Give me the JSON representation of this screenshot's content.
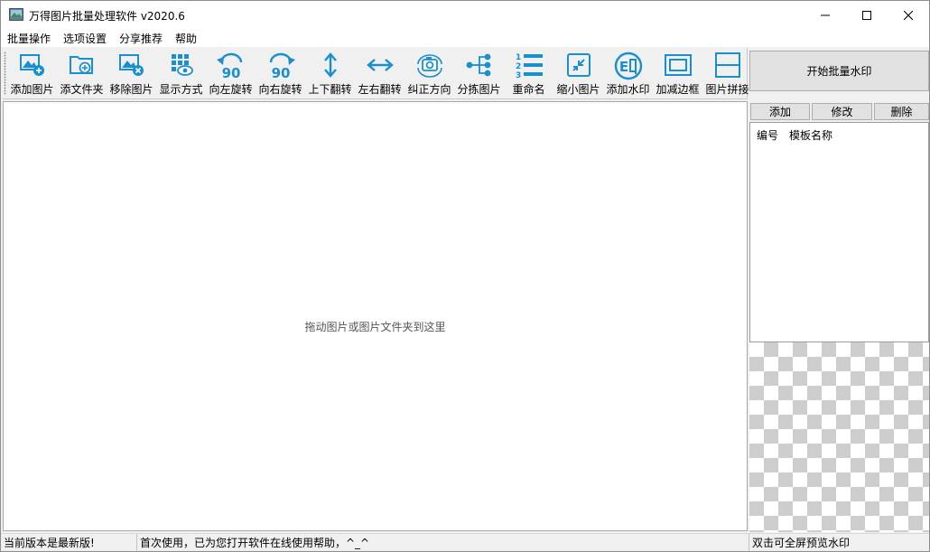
{
  "window": {
    "title": "万得图片批量处理软件 v2020.6"
  },
  "menu": [
    "批量操作",
    "选项设置",
    "分享推荐",
    "帮助"
  ],
  "toolbar": [
    {
      "label": "添加图片",
      "icon": "add-image-icon"
    },
    {
      "label": "添文件夹",
      "icon": "add-folder-icon"
    },
    {
      "label": "移除图片",
      "icon": "remove-image-icon"
    },
    {
      "label": "显示方式",
      "icon": "view-mode-icon"
    },
    {
      "label": "向左旋转",
      "icon": "rotate-left-icon"
    },
    {
      "label": "向右旋转",
      "icon": "rotate-right-icon"
    },
    {
      "label": "上下翻转",
      "icon": "flip-vertical-icon"
    },
    {
      "label": "左右翻转",
      "icon": "flip-horizontal-icon"
    },
    {
      "label": "纠正方向",
      "icon": "correct-orientation-icon"
    },
    {
      "label": "分拣图片",
      "icon": "sort-images-icon"
    },
    {
      "label": "重命名",
      "icon": "rename-icon"
    },
    {
      "label": "缩小图片",
      "icon": "shrink-image-icon"
    },
    {
      "label": "添加水印",
      "icon": "add-watermark-icon"
    },
    {
      "label": "加减边框",
      "icon": "border-icon"
    },
    {
      "label": "图片拼接",
      "icon": "stitch-images-icon"
    }
  ],
  "icon_glyph_text": {
    "rotate_degrees": "90",
    "watermark_char": "印",
    "watermark_char2": "E"
  },
  "drop_hint": "拖动图片或图片文件夹到这里",
  "side": {
    "start_label": "开始批量水印",
    "add_label": "添加",
    "edit_label": "修改",
    "delete_label": "删除",
    "col_number": "编号",
    "col_name": "模板名称"
  },
  "status": {
    "version": "当前版本是最新版!",
    "message": "首次使用，已为您打开软件在线使用帮助，^_^",
    "hint": "双击可全屏预览水印"
  },
  "colors": {
    "accent": "#1a8fd0"
  }
}
